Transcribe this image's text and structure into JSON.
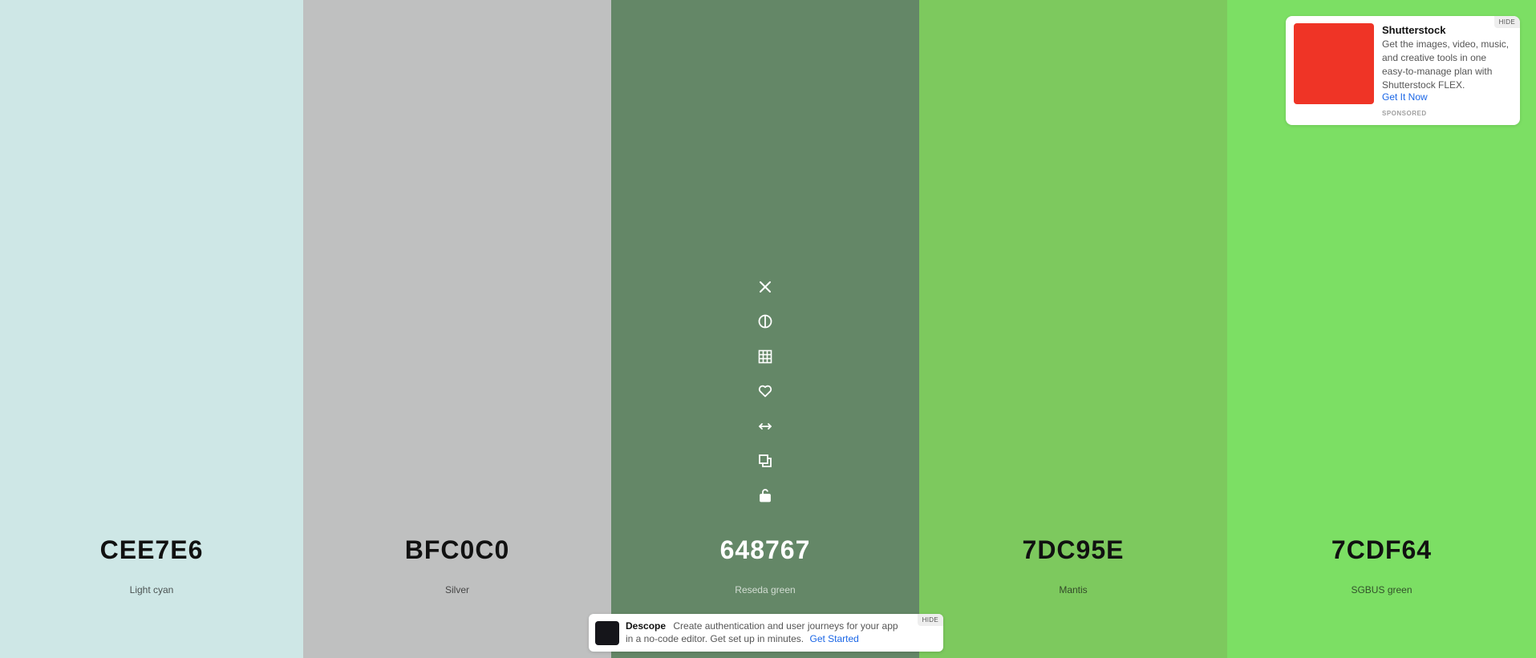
{
  "palette": {
    "colors": [
      {
        "hex": "CEE7E6",
        "name": "Light cyan",
        "bg": "#CEE7E6",
        "text_color": "#111111"
      },
      {
        "hex": "BFC0C0",
        "name": "Silver",
        "bg": "#BFC0C0",
        "text_color": "#111111"
      },
      {
        "hex": "648767",
        "name": "Reseda green",
        "bg": "#648767",
        "text_color": "#ffffff"
      },
      {
        "hex": "7DC95E",
        "name": "Mantis",
        "bg": "#7DC95E",
        "text_color": "#111111"
      },
      {
        "hex": "7CDF64",
        "name": "SGBUS green",
        "bg": "#7CDF64",
        "text_color": "#111111"
      }
    ],
    "tool_icons": [
      "close-icon",
      "contrast-icon",
      "grid-icon",
      "heart-icon",
      "drag-horizontal-icon",
      "copy-icon",
      "unlock-icon"
    ]
  },
  "ad": {
    "title": "Shutterstock",
    "body": "Get the images, video, music, and creative tools in one easy-to-manage plan with Shutterstock FLEX.",
    "cta": "Get It Now",
    "sponsored": "SPONSORED",
    "hide": "HIDE",
    "thumb_color": "#EF3426"
  },
  "banner": {
    "brand": "Descope",
    "text": "Create authentication and user journeys for your app in a no-code editor. Get set up in minutes.",
    "cta": "Get Started",
    "hide": "HIDE"
  }
}
